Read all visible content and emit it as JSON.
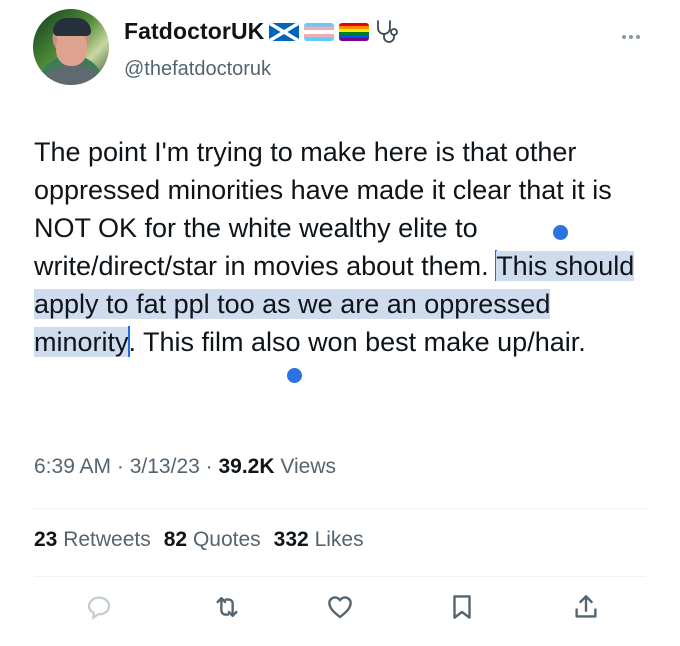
{
  "profile": {
    "display_name": "FatdoctorUK",
    "handle": "@thefatdoctoruk",
    "badges": [
      "scotland-flag-icon",
      "transgender-flag-icon",
      "rainbow-flag-icon",
      "stethoscope-icon"
    ]
  },
  "tweet": {
    "text_before": "The point I'm trying to make here is that other oppressed minorities have made it clear that it is NOT OK for the white wealthy elite to write/direct/star in movies about them. ",
    "text_selected": "This should apply to fat ppl too as we are an oppressed minority",
    "text_after": ". This film also won best make up/hair."
  },
  "meta": {
    "time": "6:39 AM",
    "sep1": " · ",
    "date": "3/13/23",
    "sep2": " · ",
    "views_count": "39.2K",
    "views_label": " Views"
  },
  "stats": {
    "retweets_count": "23",
    "retweets_label": "Retweets",
    "quotes_count": "82",
    "quotes_label": "Quotes",
    "likes_count": "332",
    "likes_label": "Likes"
  },
  "actions": [
    "reply-icon",
    "retweet-icon",
    "like-icon",
    "bookmark-icon",
    "share-icon"
  ],
  "colors": {
    "selection_highlight": "#cfdcee",
    "selection_handle": "#2a73e0",
    "secondary_text": "#536471",
    "icon_gray": "#536471"
  }
}
